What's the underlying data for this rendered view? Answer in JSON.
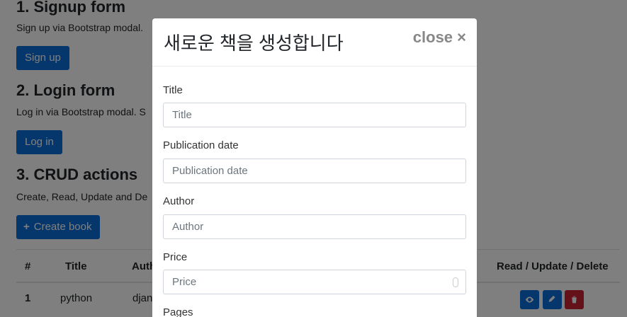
{
  "sections": {
    "signup": {
      "title": "1. Signup form",
      "text": "Sign up via Bootstrap modal.",
      "button": "Sign up"
    },
    "login": {
      "title": "2. Login form",
      "text": "Log in via Bootstrap modal. S",
      "button": "Log in"
    },
    "crud": {
      "title": "3. CRUD actions",
      "text": "Create, Read, Update and De",
      "button": "Create book",
      "button_icon": "plus-icon"
    }
  },
  "table": {
    "headers": [
      "#",
      "Title",
      "Auth",
      "Read / Update / Delete"
    ],
    "rows": [
      {
        "id": "1",
        "title": "python",
        "author": "djan"
      }
    ]
  },
  "modal": {
    "title": "새로운 책을 생성합니다",
    "close": "close ×",
    "fields": [
      {
        "label": "Title",
        "placeholder": "Title"
      },
      {
        "label": "Publication date",
        "placeholder": "Publication date"
      },
      {
        "label": "Author",
        "placeholder": "Author"
      },
      {
        "label": "Price",
        "placeholder": "Price"
      },
      {
        "label": "Pages",
        "placeholder": ""
      }
    ]
  },
  "colors": {
    "primary": "#0a6fd8",
    "info": "#0a6fd8",
    "danger": "#c82333"
  }
}
